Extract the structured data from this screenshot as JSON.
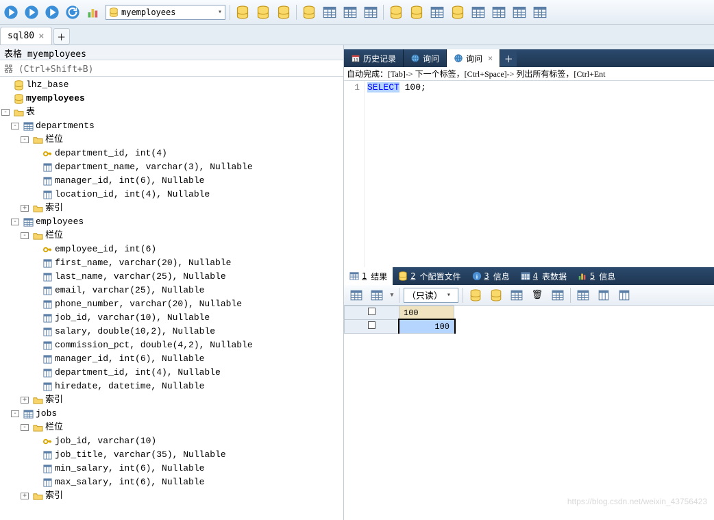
{
  "toolbar": {
    "db_select_value": "myemployees"
  },
  "conn_tab": {
    "label": "sql80"
  },
  "left": {
    "title": "表格 myemployees",
    "filter_hint": "器 (Ctrl+Shift+B)",
    "databases": [
      {
        "name": "lhz_base",
        "bold": false
      },
      {
        "name": "myemployees",
        "bold": true
      }
    ],
    "tables_label": "表",
    "columns_label": "栏位",
    "indexes_label": "索引",
    "tables": [
      {
        "name": "departments",
        "columns": [
          {
            "key": true,
            "text": "department_id, int(4)"
          },
          {
            "key": false,
            "text": "department_name, varchar(3), Nullable"
          },
          {
            "key": false,
            "text": "manager_id, int(6), Nullable"
          },
          {
            "key": false,
            "text": "location_id, int(4), Nullable"
          }
        ]
      },
      {
        "name": "employees",
        "columns": [
          {
            "key": true,
            "text": "employee_id, int(6)"
          },
          {
            "key": false,
            "text": "first_name, varchar(20), Nullable"
          },
          {
            "key": false,
            "text": "last_name, varchar(25), Nullable"
          },
          {
            "key": false,
            "text": "email, varchar(25), Nullable"
          },
          {
            "key": false,
            "text": "phone_number, varchar(20), Nullable"
          },
          {
            "key": false,
            "text": "job_id, varchar(10), Nullable"
          },
          {
            "key": false,
            "text": "salary, double(10,2), Nullable"
          },
          {
            "key": false,
            "text": "commission_pct, double(4,2), Nullable"
          },
          {
            "key": false,
            "text": "manager_id, int(6), Nullable"
          },
          {
            "key": false,
            "text": "department_id, int(4), Nullable"
          },
          {
            "key": false,
            "text": "hiredate, datetime, Nullable"
          }
        ]
      },
      {
        "name": "jobs",
        "columns": [
          {
            "key": true,
            "text": "job_id, varchar(10)"
          },
          {
            "key": false,
            "text": "job_title, varchar(35), Nullable"
          },
          {
            "key": false,
            "text": "min_salary, int(6), Nullable"
          },
          {
            "key": false,
            "text": "max_salary, int(6), Nullable"
          }
        ]
      }
    ]
  },
  "right": {
    "tabs": [
      {
        "icon": "calendar",
        "label": "历史记录",
        "active": false,
        "closable": false
      },
      {
        "icon": "globe",
        "label": "询问",
        "active": false,
        "closable": false
      },
      {
        "icon": "globe",
        "label": "询问",
        "active": true,
        "closable": true
      }
    ],
    "hint": "自动完成：[Tab]-> 下一个标签，[Ctrl+Space]-> 列出所有标签，[Ctrl+Ent",
    "editor": {
      "line_no": "1",
      "kw": "SELECT",
      "rest": " 100;"
    },
    "bottom_tabs": [
      {
        "num": "1",
        "label": "结果",
        "active": true
      },
      {
        "num": "2",
        "label": "个配置文件",
        "active": false
      },
      {
        "num": "3",
        "label": "信息",
        "active": false
      },
      {
        "num": "4",
        "label": "表数据",
        "active": false
      },
      {
        "num": "5",
        "label": "信息",
        "active": false
      }
    ],
    "readonly": "（只读）",
    "grid": {
      "header": "100",
      "row1": "100"
    }
  },
  "watermark": "https://blog.csdn.net/weixin_43756423"
}
